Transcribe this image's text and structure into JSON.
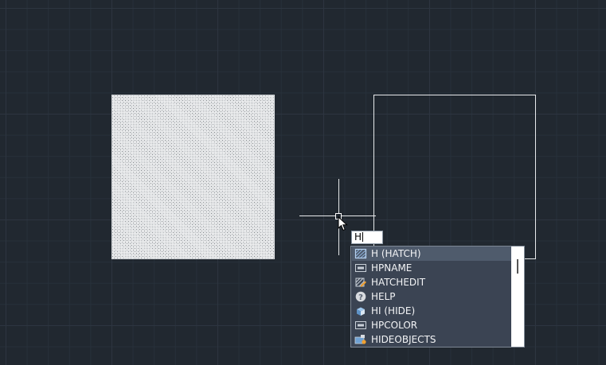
{
  "command_input": {
    "value": "H"
  },
  "autocomplete": {
    "items": [
      {
        "label": "H (HATCH)",
        "icon": "hatch-icon"
      },
      {
        "label": "HPNAME",
        "icon": "sysvar-icon"
      },
      {
        "label": "HATCHEDIT",
        "icon": "hatchedit-icon"
      },
      {
        "label": "HELP",
        "icon": "help-icon"
      },
      {
        "label": "HI (HIDE)",
        "icon": "hide-icon"
      },
      {
        "label": "HPCOLOR",
        "icon": "sysvar-icon"
      },
      {
        "label": "HIDEOBJECTS",
        "icon": "hideobjects-icon"
      }
    ],
    "selected_index": 0
  },
  "colors": {
    "background": "#212830",
    "grid": "#2d3540",
    "list_background": "#3b4453",
    "list_selected": "#4f5b6c",
    "object_white": "#e8eaec"
  }
}
